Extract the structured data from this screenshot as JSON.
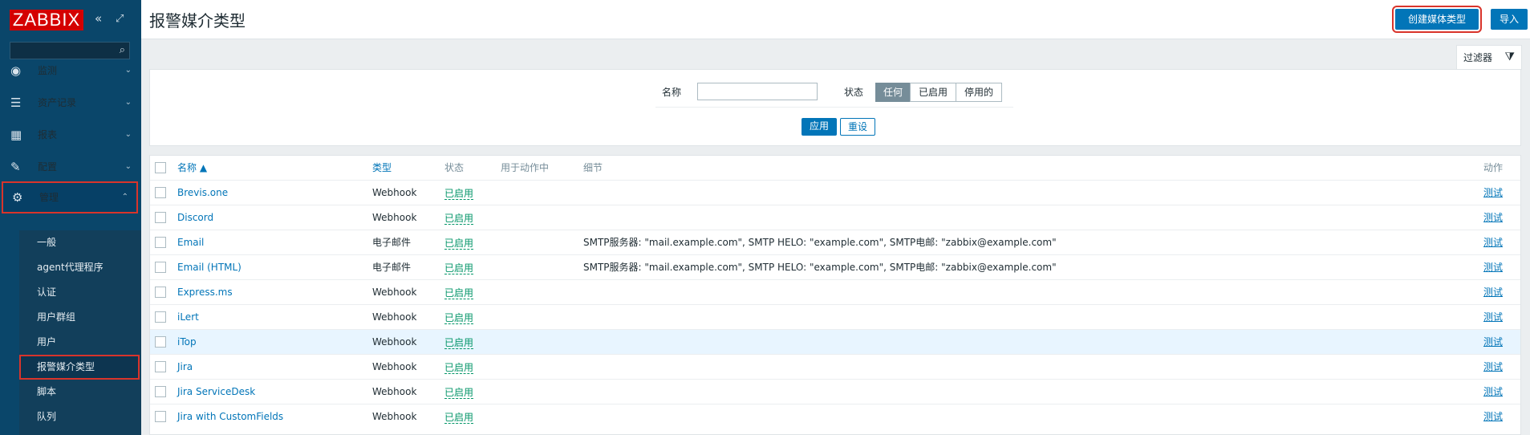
{
  "app": {
    "logo": "ZABBIX",
    "collapse_icon": "«",
    "kiosk_icon": "⤢",
    "search_icon": "⌕"
  },
  "menu": [
    {
      "label": "监测",
      "icon": "eye-icon",
      "glyph": "◉",
      "chev": "⌄",
      "active": false
    },
    {
      "label": "资产记录",
      "icon": "list-icon",
      "glyph": "☰",
      "chev": "⌄",
      "active": false
    },
    {
      "label": "报表",
      "icon": "chart-icon",
      "glyph": "▦",
      "chev": "⌄",
      "active": false
    },
    {
      "label": "配置",
      "icon": "wrench-icon",
      "glyph": "✎",
      "chev": "⌄",
      "active": false
    },
    {
      "label": "管理",
      "icon": "gear-icon",
      "glyph": "⚙",
      "chev": "⌃",
      "active": true
    }
  ],
  "submenu": [
    {
      "label": "一般"
    },
    {
      "label": "agent代理程序"
    },
    {
      "label": "认证"
    },
    {
      "label": "用户群组"
    },
    {
      "label": "用户"
    },
    {
      "label": "报警媒介类型"
    },
    {
      "label": "脚本"
    },
    {
      "label": "队列"
    }
  ],
  "header": {
    "title": "报警媒介类型",
    "create_button": "创建媒体类型",
    "import_button": "导入"
  },
  "filter": {
    "tab_label": "过滤器",
    "tab_icon": "⧩",
    "name_label": "名称",
    "name_value": "",
    "status_label": "状态",
    "status_options": [
      "任何",
      "已启用",
      "停用的"
    ],
    "status_selected": "任何",
    "apply_button": "应用",
    "reset_button": "重设"
  },
  "table": {
    "headers": {
      "name": "名称 ▲",
      "type": "类型",
      "status": "状态",
      "used_in_actions": "用于动作中",
      "details": "细节",
      "action": "动作"
    },
    "rows": [
      {
        "name": "Brevis.one",
        "type": "Webhook",
        "status": "已启用",
        "details": "",
        "action": "测试"
      },
      {
        "name": "Discord",
        "type": "Webhook",
        "status": "已启用",
        "details": "",
        "action": "测试"
      },
      {
        "name": "Email",
        "type": "电子邮件",
        "status": "已启用",
        "details": "SMTP服务器: \"mail.example.com\", SMTP HELO: \"example.com\", SMTP电邮: \"zabbix@example.com\"",
        "action": "测试"
      },
      {
        "name": "Email (HTML)",
        "type": "电子邮件",
        "status": "已启用",
        "details": "SMTP服务器: \"mail.example.com\", SMTP HELO: \"example.com\", SMTP电邮: \"zabbix@example.com\"",
        "action": "测试"
      },
      {
        "name": "Express.ms",
        "type": "Webhook",
        "status": "已启用",
        "details": "",
        "action": "测试"
      },
      {
        "name": "iLert",
        "type": "Webhook",
        "status": "已启用",
        "details": "",
        "action": "测试"
      },
      {
        "name": "iTop",
        "type": "Webhook",
        "status": "已启用",
        "details": "",
        "action": "测试"
      },
      {
        "name": "Jira",
        "type": "Webhook",
        "status": "已启用",
        "details": "",
        "action": "测试"
      },
      {
        "name": "Jira ServiceDesk",
        "type": "Webhook",
        "status": "已启用",
        "details": "",
        "action": "测试"
      },
      {
        "name": "Jira with CustomFields",
        "type": "Webhook",
        "status": "已启用",
        "details": "",
        "action": "测试"
      }
    ]
  }
}
